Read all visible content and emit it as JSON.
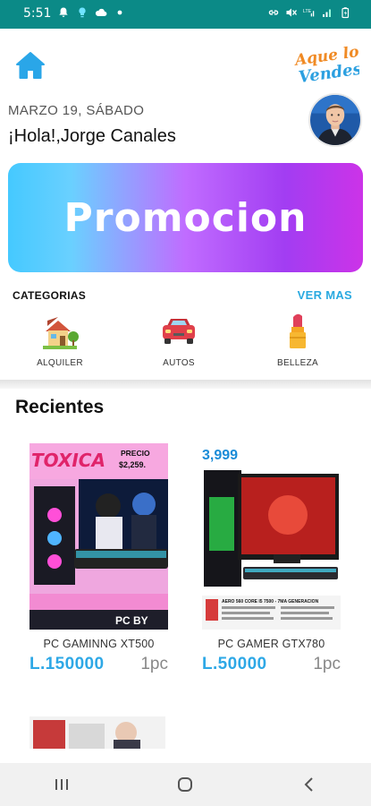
{
  "status_bar": {
    "time": "5:51",
    "left_icons": [
      "bell-icon",
      "bulb-icon",
      "cloud-icon",
      "dot-icon"
    ],
    "right_icons": [
      "link-icon",
      "mute-icon",
      "lte-signal-icon",
      "signal-icon",
      "battery-icon"
    ],
    "color": "#0b8a87"
  },
  "header": {
    "home_icon": "home-icon",
    "logo_text": "Aque lo Vendes",
    "date": "MARZO 19, SÁBADO",
    "greeting": "¡Hola!,Jorge Canales",
    "avatar_icon": "user-avatar"
  },
  "promo": {
    "text": "Promocion"
  },
  "categories": {
    "title": "CATEGORIAS",
    "more": "VER MAS",
    "items": [
      {
        "label": "ALQUILER",
        "icon": "house-icon"
      },
      {
        "label": "AUTOS",
        "icon": "car-icon"
      },
      {
        "label": "BELLEZA",
        "icon": "lipstick-icon"
      }
    ]
  },
  "recientes": {
    "title": "Recientes",
    "products": [
      {
        "name": "PC GAMINNG XT500",
        "price": "L.150000",
        "qty": "1pc",
        "image_text": {
          "brand": "TOXICA",
          "price_label": "PRECIO",
          "price": "$2,259.",
          "footer": "PC BY"
        }
      },
      {
        "name": "PC GAMER GTX780",
        "price": "L.50000",
        "qty": "1pc",
        "image_text": {
          "price": "3,999",
          "spec": "AERO 560 CORE I5 7500 - 7MA GENERACION"
        }
      }
    ]
  },
  "colors": {
    "accent": "#29a9e0",
    "price": "#2ea8e6",
    "logo_orange": "#f08a24",
    "logo_blue": "#2ca0e0"
  },
  "navbar": {
    "icons": [
      "recent-apps-icon",
      "home-circle-icon",
      "back-icon"
    ]
  }
}
